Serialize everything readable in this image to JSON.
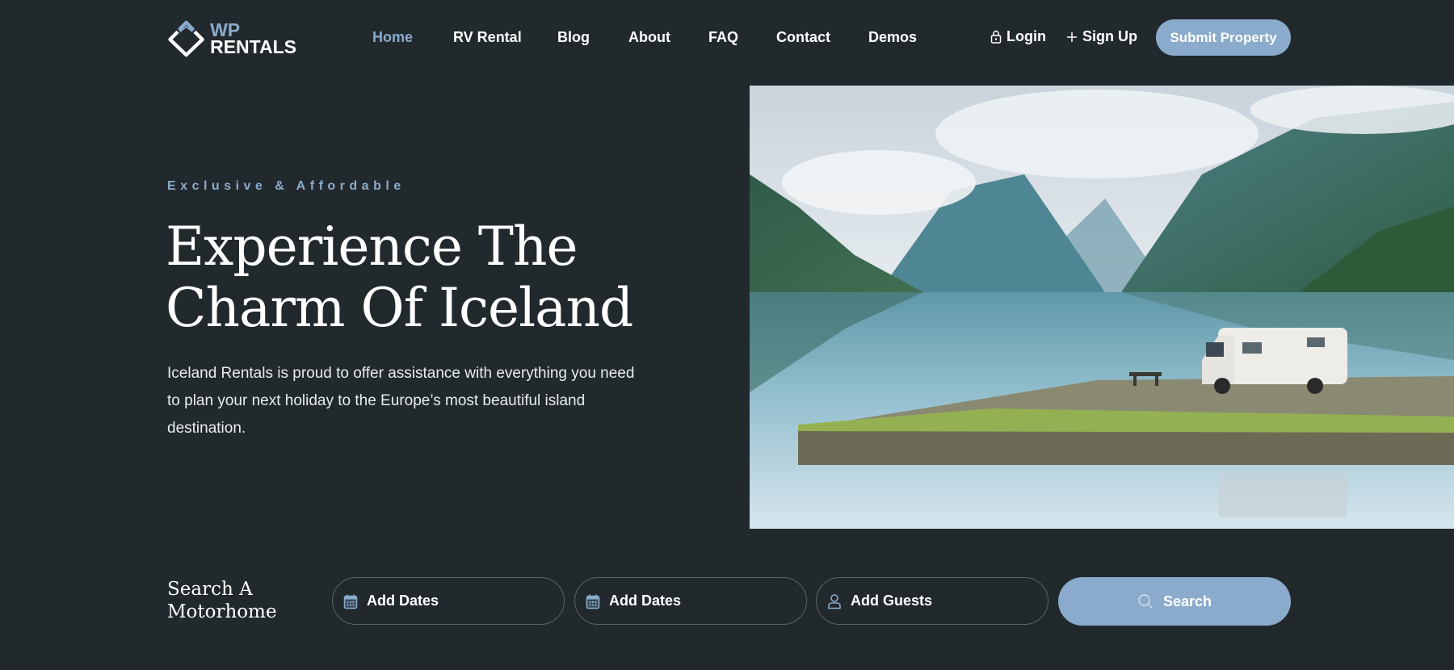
{
  "brand": {
    "line1": "WP",
    "line2": "RENTALS",
    "accent": "#8aabcb"
  },
  "nav": {
    "items": [
      {
        "label": "Home",
        "active": true
      },
      {
        "label": "RV Rental",
        "active": false
      },
      {
        "label": "Blog",
        "active": false
      },
      {
        "label": "About",
        "active": false
      },
      {
        "label": "FAQ",
        "active": false
      },
      {
        "label": "Contact",
        "active": false
      },
      {
        "label": "Demos",
        "active": false
      }
    ]
  },
  "auth": {
    "login": {
      "label": "Login",
      "icon": "lock-icon"
    },
    "signup": {
      "label": "Sign Up",
      "icon": "plus-icon"
    },
    "submit": "Submit Property"
  },
  "hero": {
    "tagline": "Exclusive & Affordable",
    "headline_line1": "Experience The",
    "headline_line2": "Charm Of Iceland",
    "description": "Iceland Rentals is proud to offer assistance with everything you need to plan your next holiday to the Europe’s most beautiful island destination.",
    "image_alt": "Motorhome parked beside a mirror-calm fjord lake surrounded by misty mountains"
  },
  "search": {
    "title_line1": "Search A",
    "title_line2": "Motorhome",
    "checkin": {
      "label": "Add Dates",
      "icon": "calendar-icon"
    },
    "checkout": {
      "label": "Add Dates",
      "icon": "calendar-icon"
    },
    "guests": {
      "label": "Add Guests",
      "icon": "user-icon"
    },
    "button": {
      "label": "Search",
      "icon": "search-icon"
    }
  },
  "colors": {
    "background": "#22292d",
    "accent": "#8aabcb",
    "text": "#ffffff"
  }
}
